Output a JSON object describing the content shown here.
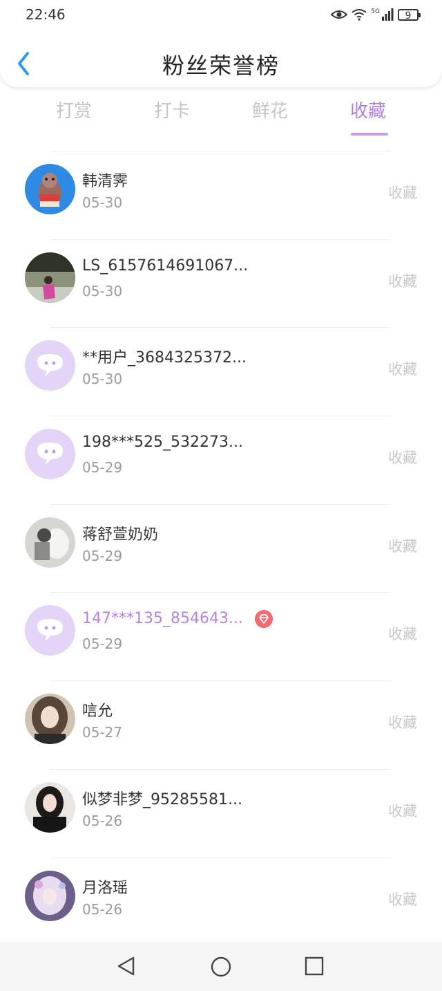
{
  "status_bar": {
    "time": "22:46",
    "signal_label": "5G",
    "battery": "9"
  },
  "header": {
    "title": "粉丝荣誉榜"
  },
  "tabs": [
    {
      "label": "打赏",
      "active": false
    },
    {
      "label": "打卡",
      "active": false
    },
    {
      "label": "鲜花",
      "active": false
    },
    {
      "label": "收藏",
      "active": true
    }
  ],
  "fans": [
    {
      "name": "韩清霁",
      "date": "05-30",
      "action": "收藏",
      "avatar": "cartoon-character"
    },
    {
      "name": "LS_6157614691067...",
      "date": "05-30",
      "action": "收藏",
      "avatar": "photo-outdoor"
    },
    {
      "name": "**用户_3684325372...",
      "date": "05-30",
      "action": "收藏",
      "avatar": "default-chat"
    },
    {
      "name": "198***525_532273...",
      "date": "05-29",
      "action": "收藏",
      "avatar": "default-chat"
    },
    {
      "name": "蒋舒萱奶奶",
      "date": "05-29",
      "action": "收藏",
      "avatar": "photo-plush"
    },
    {
      "name": "147***135_854643...",
      "date": "05-29",
      "action": "收藏",
      "avatar": "default-chat",
      "vip": true
    },
    {
      "name": "唁允",
      "date": "05-27",
      "action": "收藏",
      "avatar": "photo-girl"
    },
    {
      "name": "似梦非梦_95285581...",
      "date": "05-26",
      "action": "收藏",
      "avatar": "photo-girl-dark"
    },
    {
      "name": "月洛瑶",
      "date": "05-26",
      "action": "收藏",
      "avatar": "anime-girl"
    }
  ],
  "colors": {
    "accent": "#b07fde",
    "vip_name": "#b584e2",
    "gem": "#f36b72",
    "back_arrow": "#2a9df4"
  },
  "icons": {
    "back": "chevron-left-icon",
    "vip": "gem-icon"
  }
}
